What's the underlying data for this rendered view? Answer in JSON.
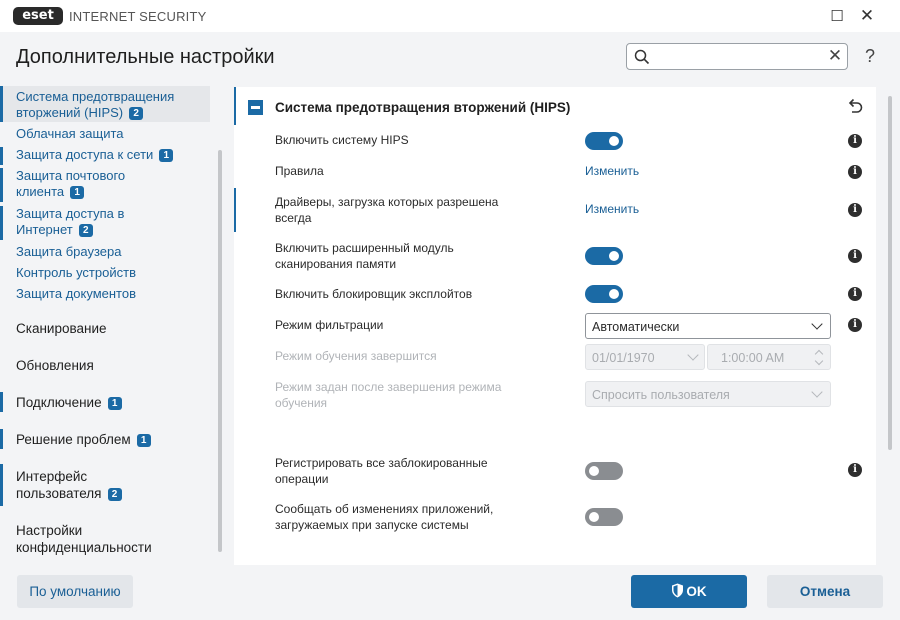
{
  "window": {
    "logo_text": "eset",
    "app_title": "INTERNET SECURITY",
    "maximize_glyph": "☐",
    "close_glyph": "✕"
  },
  "header": {
    "page_title": "Дополнительные настройки",
    "search_value": "",
    "search_placeholder": "",
    "search_clear_glyph": "✕",
    "help_glyph": "?"
  },
  "sidebar": {
    "items": [
      {
        "label": "Система предотвращения вторжений (HIPS)",
        "badge": "2",
        "selected": true
      },
      {
        "label": "Облачная защита",
        "badge": ""
      },
      {
        "label": "Защита доступа к сети",
        "badge": "1"
      },
      {
        "label": "Защита почтового клиента",
        "badge": "1"
      },
      {
        "label": "Защита доступа в Интернет",
        "badge": "2"
      },
      {
        "label": "Защита браузера",
        "badge": ""
      },
      {
        "label": "Контроль устройств",
        "badge": ""
      },
      {
        "label": "Защита документов",
        "badge": ""
      }
    ],
    "sections": [
      {
        "label": "Сканирование",
        "badge": ""
      },
      {
        "label": "Обновления",
        "badge": ""
      },
      {
        "label": "Подключение",
        "badge": "1"
      },
      {
        "label": "Решение проблем",
        "badge": "1"
      },
      {
        "label": "Интерфейс пользователя",
        "badge": "2"
      },
      {
        "label": "Настройки конфиденциальности",
        "badge": ""
      }
    ]
  },
  "main": {
    "section_title": "Система предотвращения вторжений (HIPS)",
    "rows": {
      "enable_hips": {
        "label": "Включить систему HIPS",
        "state": "on"
      },
      "rules": {
        "label": "Правила",
        "link": "Изменить"
      },
      "drivers": {
        "label": "Драйверы, загрузка которых разрешена всегда",
        "link": "Изменить"
      },
      "advanced_memory": {
        "label": "Включить расширенный модуль сканирования памяти",
        "state": "on"
      },
      "exploit_blocker": {
        "label": "Включить блокировщик эксплойтов",
        "state": "on"
      },
      "filter_mode": {
        "label": "Режим фильтрации",
        "value": "Автоматически"
      },
      "learning_end": {
        "label": "Режим обучения завершится",
        "date": "01/01/1970",
        "time": "1:00:00 AM"
      },
      "after_learning": {
        "label": "Режим задан после завершения режима обучения",
        "value": "Спросить пользователя"
      },
      "log_blocked": {
        "label": "Регистрировать все заблокированные операции",
        "state": "off"
      },
      "notify_changes": {
        "label": "Сообщать об изменениях приложений, загружаемых при запуске системы",
        "state": "off"
      }
    },
    "info_glyph": "i"
  },
  "footer": {
    "default_label": "По умолчанию",
    "ok_label": "OK",
    "cancel_label": "Отмена"
  },
  "colors": {
    "accent": "#1b6aa5",
    "link": "#1a5f95",
    "toggle_off": "#8a8d91",
    "background": "#f3f4f6"
  }
}
